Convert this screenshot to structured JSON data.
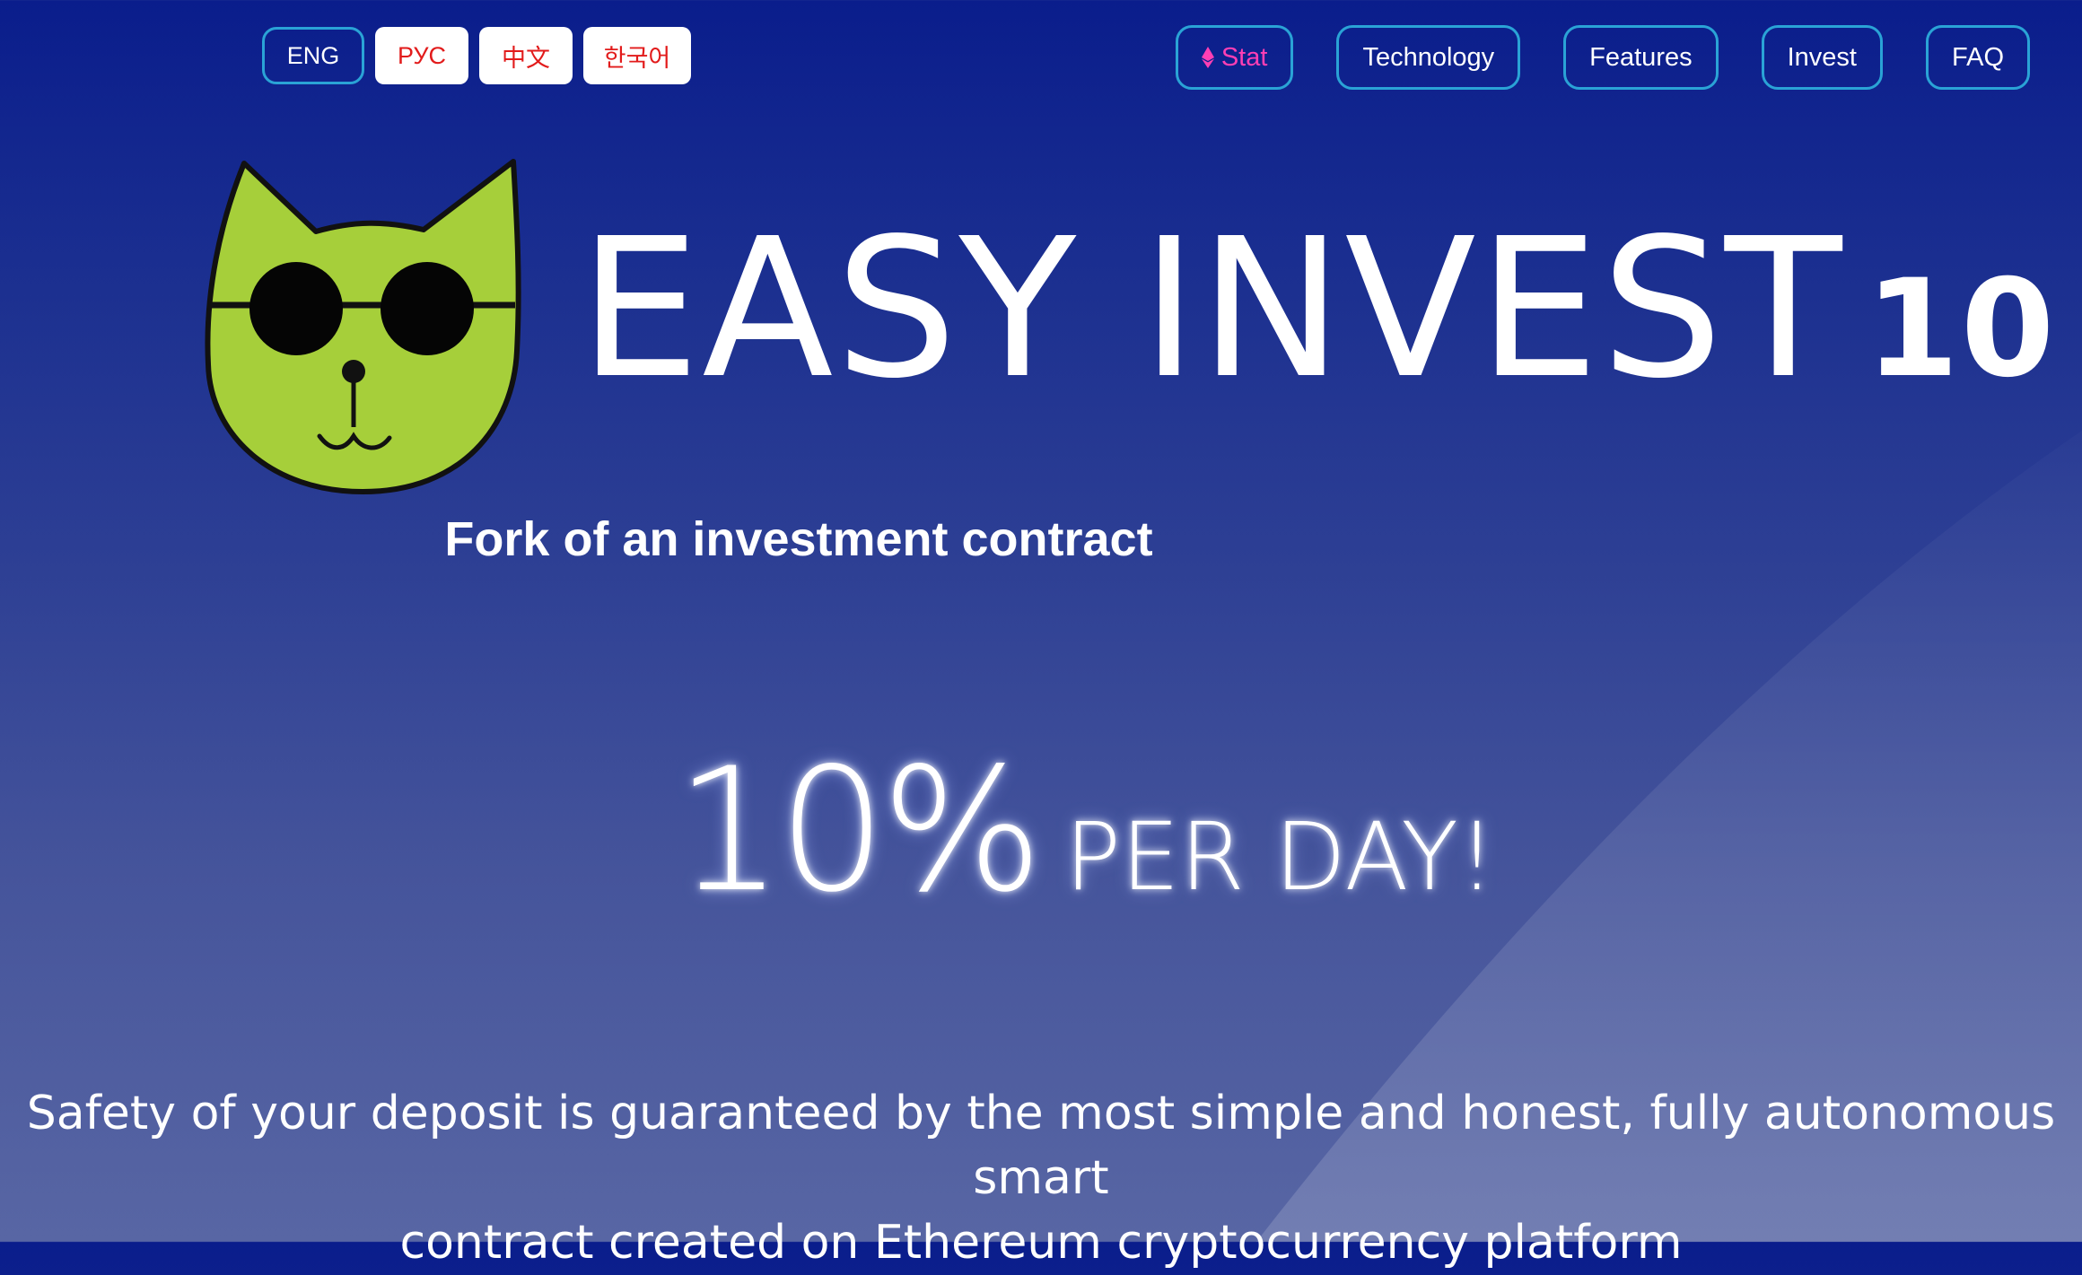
{
  "languages": [
    {
      "label": "ENG",
      "active": true
    },
    {
      "label": "РУС",
      "active": false
    },
    {
      "label": "中文",
      "active": false
    },
    {
      "label": "한국어",
      "active": false
    }
  ],
  "nav": {
    "stat": "Stat",
    "technology": "Technology",
    "features": "Features",
    "invest": "Invest",
    "faq": "FAQ"
  },
  "hero": {
    "brand": "EASY INVEST",
    "brand_number": "10",
    "subtitle": "Fork of an investment contract",
    "rate_value": "10%",
    "rate_suffix": "PER DAY!",
    "tagline_line1": "Safety of your deposit is guaranteed by the most simple and honest, fully autonomous smart",
    "tagline_line2": "contract created on Ethereum cryptocurrency platform"
  },
  "icons": {
    "logo": "cat-with-sunglasses-logo",
    "stat": "ethereum-icon"
  },
  "colors": {
    "background_top": "#0a1d8c",
    "background_bottom": "#5866a4",
    "button_border": "#2aa3d6",
    "stat_accent": "#ff3fb4",
    "lang_inactive_text": "#e21b1b",
    "logo_green": "#a6cf3a"
  }
}
